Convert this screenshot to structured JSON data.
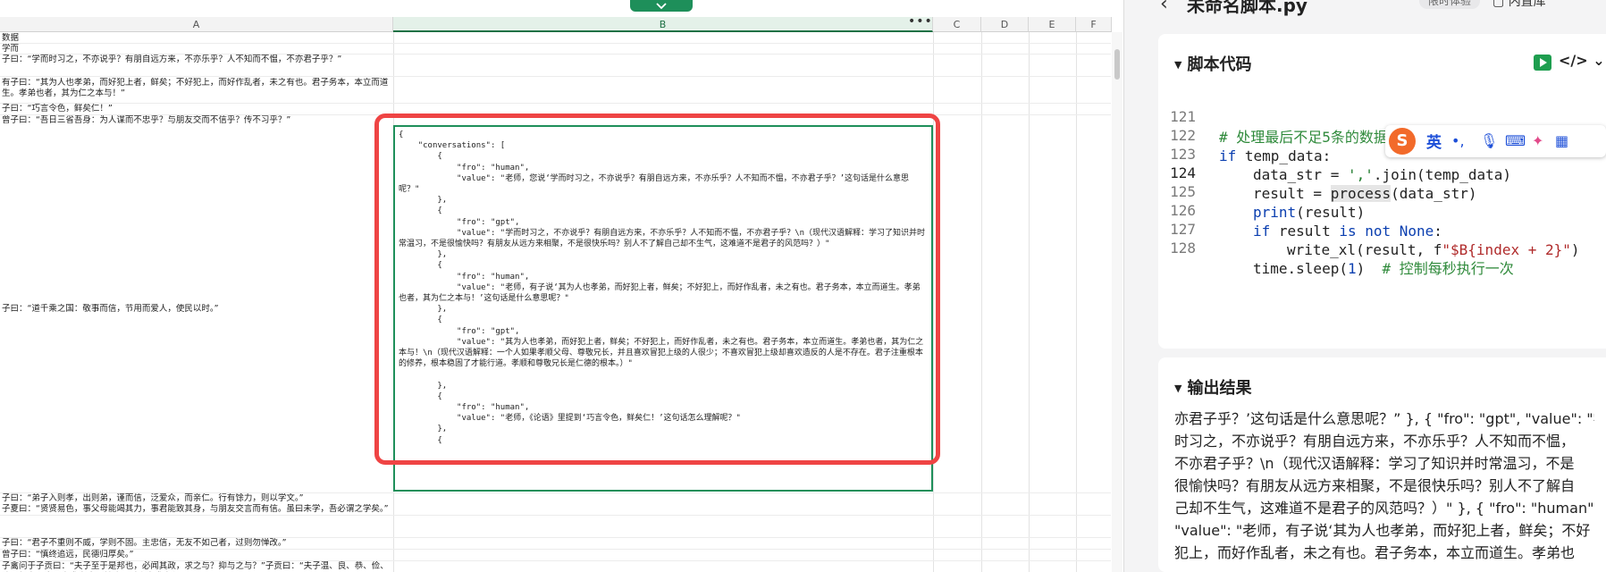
{
  "sheet": {
    "columns": [
      "A",
      "B",
      "C",
      "D",
      "E",
      "F"
    ],
    "rows": [
      "数据",
      "学而",
      "子曰：“学而时习之，不亦说乎？有朋自远方来，不亦乐乎？人不知而不愠，不亦君子乎？”",
      "有子曰：“其为人也孝弟，而好犯上者，鲜矣；不好犯上，而好作乱者，未之有也。君子务本，本立而道生。孝弟也者，其为仁之本与！”",
      "子曰：“巧言令色，鲜矣仁！”",
      "曾子曰：“吾日三省吾身：为人谋而不忠乎？与朋友交而不信乎？传不习乎？”",
      "子曰：“道千乘之国：敬事而信，节用而爱人，使民以时。”",
      "子曰：“弟子入则孝，出则弟，谨而信，泛爱众，而亲仁。行有馀力，则以学文。”",
      "子夏曰：“贤贤易色，事父母能竭其力，事君能致其身，与朋友交言而有信。虽曰未学，吾必谓之学矣。”",
      "子曰：“君子不重则不威，学则不固。主忠信，无友不如己者，过则勿惮改。”",
      "曾子曰：“慎终追远，民德归厚矣。”",
      "子禽问于子贡曰：“夫子至于是邦也，必闻其政，求之与？抑与之与？”子贡曰：“夫子温、良、恭、俭、让以得之。夫子之求之也，其诸异乎人之求之与？”"
    ],
    "selected_cell_text": "{\n    \"conversations\": [\n        {\n            \"fro\": \"human\",\n            \"value\": \"老师，您说‘学而时习之，不亦说乎？有朋自远方来，不亦乐乎？人不知而不愠，不亦君子乎？’这句话是什么意思呢？\"\n        },\n        {\n            \"fro\": \"gpt\",\n            \"value\": \"学而时习之，不亦说乎？有朋自远方来，不亦乐乎？人不知而不愠，不亦君子乎？\\n（现代汉语解释：学习了知识并时常温习，不是很愉快吗？有朋友从远方来相聚，不是很快乐吗？别人不了解自己却不生气，这难道不是君子的风范吗？）\"\n        },\n        {\n            \"fro\": \"human\",\n            \"value\": \"老师，有子说‘其为人也孝弟，而好犯上者，鲜矣；不好犯上，而好作乱者，未之有也。君子务本，本立而道生。孝弟也者，其为仁之本与！’这句话是什么意思呢？\"\n        },\n        {\n            \"fro\": \"gpt\",\n            \"value\": \"其为人也孝弟，而好犯上者，鲜矣；不好犯上，而好作乱者，未之有也。君子务本，本立而道生。孝弟也者，其为仁之本与！\\n（现代汉语解释：一个人如果孝顺父母、尊敬兄长，并且喜欢冒犯上级的人很少；不喜欢冒犯上级却喜欢造反的人是不存在。君子注重根本的修养，根本稳固了才能行道。孝顺和尊敬兄长是仁德的根本。）\"\n\n        },\n        {\n            \"fro\": \"human\",\n            \"value\": \"老师，《论语》里提到‘巧言令色，鲜矣仁！’这句话怎么理解呢？\"\n        },\n        {"
  },
  "panel": {
    "title": "未命名脚本.py",
    "badge": "限时体验",
    "library": "内置库",
    "code_section_title": "脚本代码",
    "code_toggle": "</>",
    "code_lines": [
      {
        "num": "121",
        "text": "# 处理最后不足5条的数据"
      },
      {
        "num": "122",
        "text": "if temp_data:"
      },
      {
        "num": "123",
        "text": "data_str = ','.join(temp_data)"
      },
      {
        "num": "124",
        "text": "result = process(data_str)"
      },
      {
        "num": "125",
        "text": "print(result)"
      },
      {
        "num": "126",
        "text": "if result is not None:"
      },
      {
        "num": "127",
        "text": "write_xl(result, f\"$B{index + 2}\")"
      },
      {
        "num": "128",
        "text": "time.sleep(1)  # 控制每秒执行一次"
      }
    ],
    "output_section_title": "输出结果",
    "output_lines": [
      "亦君子乎？’这句话是什么意思呢？” }, { \"fro\": \"gpt\", \"value\": \"学而",
      "时习之，不亦说乎？有朋自远方来，不亦乐乎？人不知而不愠，",
      "不亦君子乎？\\n（现代汉语解释：学习了知识并时常温习，不是",
      "很愉快吗？有朋友从远方来相聚，不是很快乐吗？别人不了解自",
      "己却不生气，这难道不是君子的风范吗？）\" }, { \"fro\": \"human\",",
      "\"value\": \"老师，有子说‘其为人也孝弟，而好犯上者，鲜矣；不好",
      "犯上，而好作乱者，未之有也。君子务本，本立而道生。孝弟也"
    ]
  },
  "ime": {
    "logo": "S",
    "lang": "英",
    "punct": "•,"
  },
  "colors": {
    "accent_green": "#1e8f5a",
    "highlight_red": "#ef4444",
    "keyword_blue": "#0b3fb0",
    "comment_green": "#2f8a3b"
  }
}
